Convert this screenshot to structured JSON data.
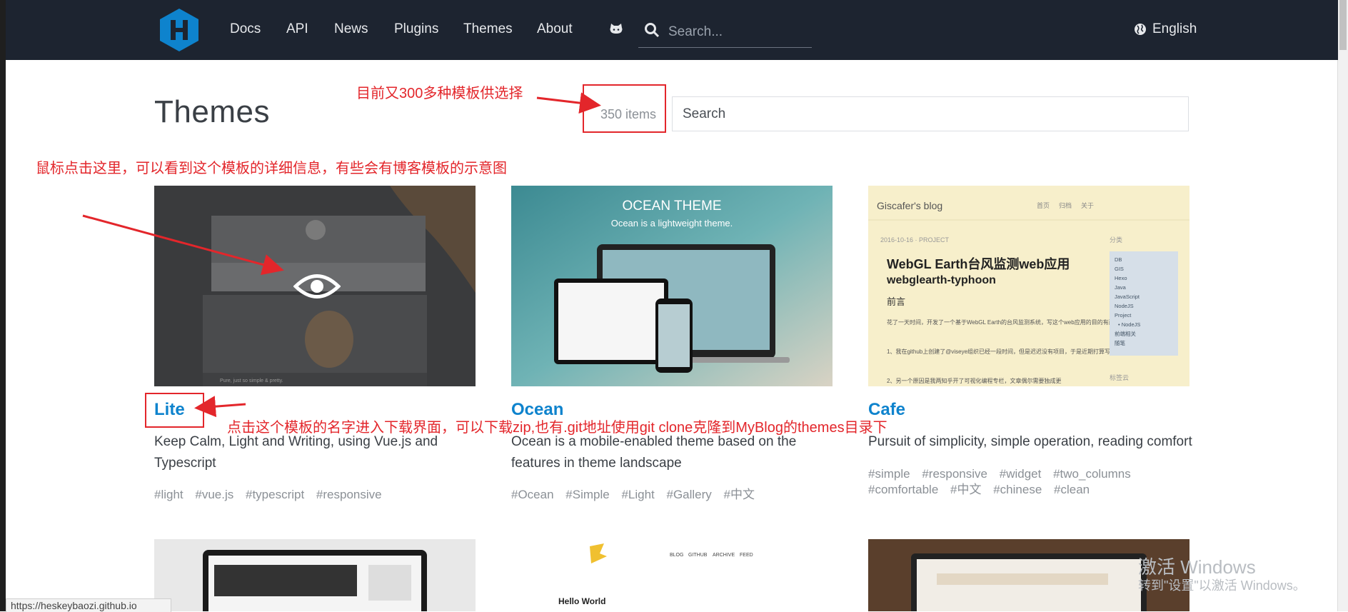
{
  "header": {
    "nav": [
      "Docs",
      "API",
      "News",
      "Plugins",
      "Themes",
      "About"
    ],
    "search_placeholder": "Search...",
    "language": "English"
  },
  "page": {
    "title": "Themes",
    "count": "350 items",
    "search_placeholder": "Search"
  },
  "annotations": {
    "count_note": "目前又300多种模板供选择",
    "thumb_note": "鼠标点击这里，可以看到这个模板的详细信息，有些会有博客模板的示意图",
    "name_note": "点击这个模板的名字进入下载界面，可以下载zip,也有.git地址使用git clone克隆到MyBlog的themes目录下"
  },
  "themes": [
    {
      "name": "Lite",
      "desc": "Keep Calm, Light and Writing, using Vue.js and Typescript",
      "tags": [
        "#light",
        "#vue.js",
        "#typescript",
        "#responsive"
      ],
      "thumb_text": "Pure, just so simple & pretty."
    },
    {
      "name": "Ocean",
      "desc": "Ocean is a mobile-enabled theme based on the features in theme landscape",
      "tags": [
        "#Ocean",
        "#Simple",
        "#Light",
        "#Gallery",
        "#中文"
      ],
      "thumb_title": "OCEAN THEME",
      "thumb_sub": "Ocean is a lightweight theme."
    },
    {
      "name": "Cafe",
      "desc": "Pursuit of simplicity, simple operation, reading comfort",
      "tags": [
        "#simple",
        "#responsive",
        "#widget",
        "#two_columns",
        "#comfortable",
        "#中文",
        "#chinese",
        "#clean"
      ],
      "thumb": {
        "blog": "Giscafer's blog",
        "menu": [
          "首页",
          "归档",
          "关于"
        ],
        "date": "2016-10-16 · PROJECT",
        "title1": "WebGL Earth台风监测web应用",
        "title2": "webglearth-typhoon",
        "heading": "前言",
        "p1": "花了一天时间，开发了一个基于WebGL Earth的台风监测系统，写这个web应用的目的有两个：",
        "p2": "1、我在github上创建了@viseye组织已经一段时间，但是迟迟没有项目，于是近期打算写一个",
        "p3": "2、另一个原因是我两知乎开了可视化编程专栏，文章偶尔需要独成更",
        "cat_title": "分类",
        "cats": [
          "DB",
          "GIS",
          "Hexo",
          "Java",
          "JavaScript",
          "NodeJS",
          "Project",
          "• NodeJS",
          "前端相关",
          "随笔"
        ],
        "tags_title": "标签云"
      }
    }
  ],
  "row2": {
    "mid_nav": [
      "BLOG",
      "GITHUB",
      "ARCHIVE",
      "FEED"
    ],
    "mid_post": "Hello World"
  },
  "status_url": "https://heskeybaozi.github.io",
  "watermark": {
    "line1": "激活 Windows",
    "line2": "转到\"设置\"以激活 Windows。"
  }
}
